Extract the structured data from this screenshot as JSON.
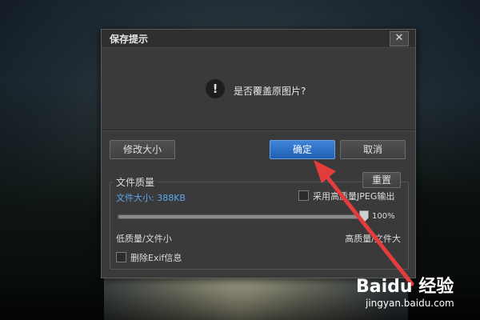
{
  "dialog": {
    "title": "保存提示",
    "close_label": "✕",
    "message_icon": "!",
    "message": "是否覆盖原图片?",
    "buttons": {
      "resize": "修改大小",
      "ok": "确定",
      "cancel": "取消"
    },
    "quality": {
      "group_title": "文件质量",
      "reset_label": "重置",
      "file_size": "文件大小: 388KB",
      "jpeg_high_quality_label": "采用高质量JPEG输出",
      "jpeg_high_quality_checked": false,
      "slider_percent": "100%",
      "slider_value": 1.0,
      "low_quality_label": "低质量/文件小",
      "high_quality_label": "高质量/文件大",
      "remove_exif_label": "删除Exif信息",
      "remove_exif_checked": false
    }
  },
  "watermark": {
    "name": "Baidu 经验",
    "url": "jingyan.baidu.com"
  },
  "colors": {
    "accent_blue": "#2c6fc7",
    "file_size_blue": "#5aa6ee",
    "arrow_red": "#e23c3c"
  }
}
